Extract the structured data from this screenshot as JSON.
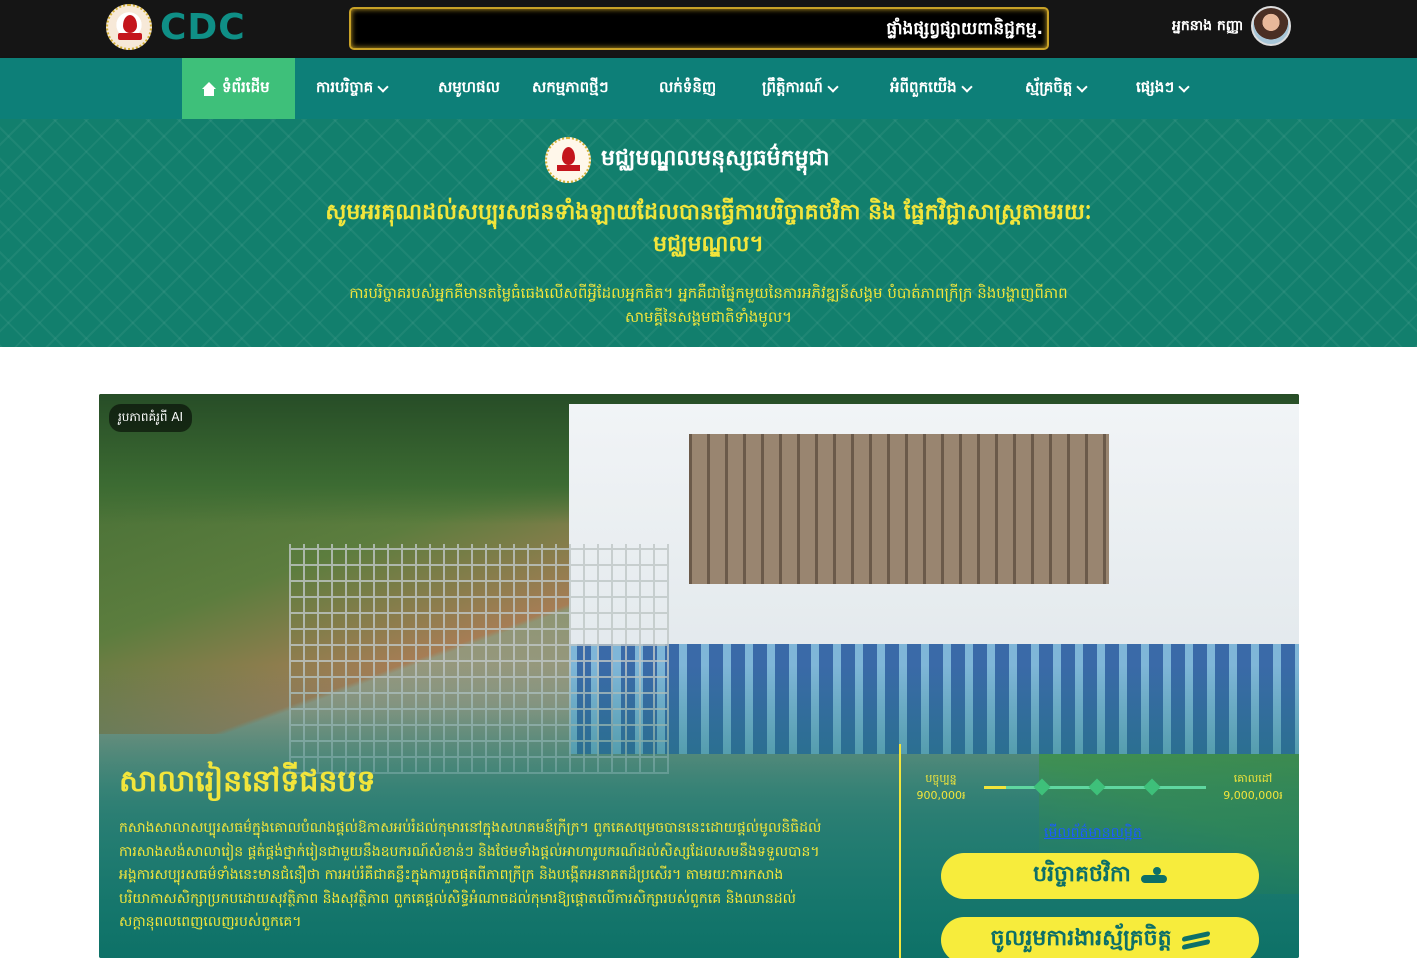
{
  "header": {
    "brand": "CDC",
    "ticker": "ផ្ទាំងផ្សព្វផ្សាយពានិជ្ជកម្ម.",
    "user_name": "អ្នកនាង កញ្ញា"
  },
  "nav": {
    "items": [
      {
        "label": "ទំព័រដើម",
        "icon": "home-icon"
      },
      {
        "label": "ការបរិច្ចាគ",
        "dropdown": true
      },
      {
        "label": "សមូហផល"
      },
      {
        "label": "សកម្មភាពថ្មីៗ"
      },
      {
        "label": "លក់ទំនិញ"
      },
      {
        "label": "ព្រឹត្តិការណ៍",
        "dropdown": true
      },
      {
        "label": "អំពីពួកយើង",
        "dropdown": true
      },
      {
        "label": "ស្ម័គ្រចិត្ត",
        "dropdown": true
      },
      {
        "label": "ផ្សេងៗ",
        "dropdown": true
      }
    ]
  },
  "hero": {
    "title": "មជ្ឈមណ្ឌលមនុស្សធម៌កម្ពុជា",
    "subtitle": "សូមអរគុណដល់សប្បុរសជនទាំងឡាយដែលបានធ្វើការបរិច្ចាគថវិកា និង ផ្នែកវិជ្ជាសាស្ត្រតាមរយៈមជ្ឈមណ្ឌល។",
    "description": "ការបរិច្ចាគរបស់អ្នកគឺមានតម្លៃធំធេងលើសពីអ្វីដែលអ្នកគិត។ អ្នកគឺជាផ្នែកមួយនៃការអភិវឌ្ឍន៍សង្គម បំបាត់ភាពក្រីក្រ និងបង្ហាញពីភាពសាមគ្គីនៃសង្គមជាតិទាំងមូល។"
  },
  "project": {
    "ai_badge": "រូបភាពគំរូពី AI",
    "title": "សាលារៀននៅទីជនបទ",
    "description": "កសាងសាលាសប្បុរសធម៌ក្នុងគោលបំណងផ្តល់ឱកាសអប់រំដល់កុមារនៅក្នុងសហគមន៍ក្រីក្រ។ ពួកគេសម្រេចបាននេះដោយផ្តល់មូលនិធិដល់ការសាងសង់សាលារៀន ផ្គត់ផ្គង់ថ្នាក់រៀនជាមួយនឹងឧបករណ៍សំខាន់ៗ និងថែមទាំងផ្តល់អាហារូបករណ៍ដល់សិស្សដែលសមនឹងទទួលបាន។ អង្គការសប្បុរសធម៌ទាំងនេះមានជំនឿថា ការអប់រំគឺជាគន្លឹះក្នុងការរួចផុតពីភាពក្រីក្រ និងបង្កើតអនាគតដ៏ប្រសើរ។ តាមរយៈការកសាងបរិយាកាសសិក្សាប្រកបដោយសុវត្ថិភាព និងសុវត្ថិភាព ពួកគេផ្តល់សិទ្ធិអំណាចដល់កុមារឱ្យផ្តោតលើការសិក្សារបស់ពួកគេ និងឈានដល់សក្តានុពលពេញលេញរបស់ពួកគេ។",
    "progress": {
      "current_label": "បច្ចុប្បន្ន",
      "current_value": "900,000៛",
      "goal_label": "គោលដៅ",
      "goal_value": "9,000,000៛",
      "fraction": 0.1
    },
    "more_link": "មើលព័ត៌មានលម្អិត",
    "donate_button": "បរិច្ចាគថវិកា",
    "volunteer_button": "ចូលរួមការងារស្ម័គ្រចិត្ត"
  },
  "colors": {
    "topbar": "#151515",
    "nav": "#0d7f78",
    "nav_active": "#3ec07a",
    "accent_yellow": "#f2e53b",
    "brand_teal": "#0f8f86"
  }
}
